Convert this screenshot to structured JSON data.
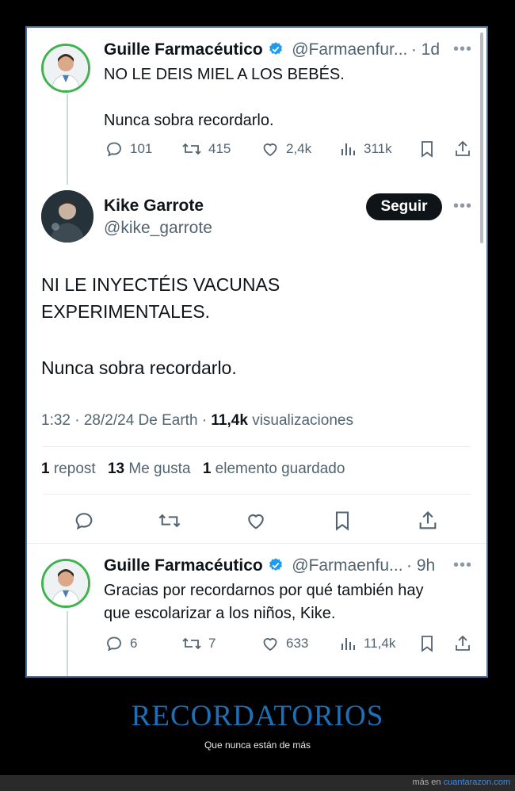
{
  "tweet1": {
    "name": "Guille Farmacéutico",
    "handle": "@Farmaenfur...",
    "time": "· 1d",
    "line1": "NO LE DEIS MIEL A LOS BEBÉS.",
    "line2": "Nunca sobra recordarlo.",
    "replies": "101",
    "reposts": "415",
    "likes": "2,4k",
    "views": "311k"
  },
  "tweet2": {
    "name": "Kike Garrote",
    "handle": "@kike_garrote",
    "follow_label": "Seguir",
    "line1": "NI LE INYECTÉIS VACUNAS",
    "line2": "EXPERIMENTALES.",
    "line3": "Nunca sobra recordarlo.",
    "meta_time": "1:32 · 28/2/24 De Earth ·",
    "meta_views_count": "11,4k",
    "meta_views_label": "visualizaciones",
    "stats": {
      "reposts_count": "1",
      "reposts_label": "repost",
      "likes_count": "13",
      "likes_label": "Me gusta",
      "bookmarks_count": "1",
      "bookmarks_label": "elemento guardado"
    }
  },
  "tweet3": {
    "name": "Guille Farmacéutico",
    "handle": "@Farmaenfu...",
    "time": "· 9h",
    "line1": "Gracias por recordarnos por qué también hay",
    "line2": "que escolarizar a los niños, Kike.",
    "replies": "6",
    "reposts": "7",
    "likes": "633",
    "views": "11,4k"
  },
  "footer": {
    "title": "RECORDATORIOS",
    "subtitle": "Que nunca están de más",
    "credit_prefix": "más en",
    "credit_site": "cuantarazon.com"
  },
  "colors": {
    "verified": "#1d9bf0",
    "avatar_ring": "#3fb44e",
    "footer_title": "#1d6fb8"
  },
  "icons": [
    "reply-icon",
    "repost-icon",
    "like-icon",
    "views-icon",
    "bookmark-icon",
    "share-icon",
    "more-icon",
    "verified-icon"
  ]
}
